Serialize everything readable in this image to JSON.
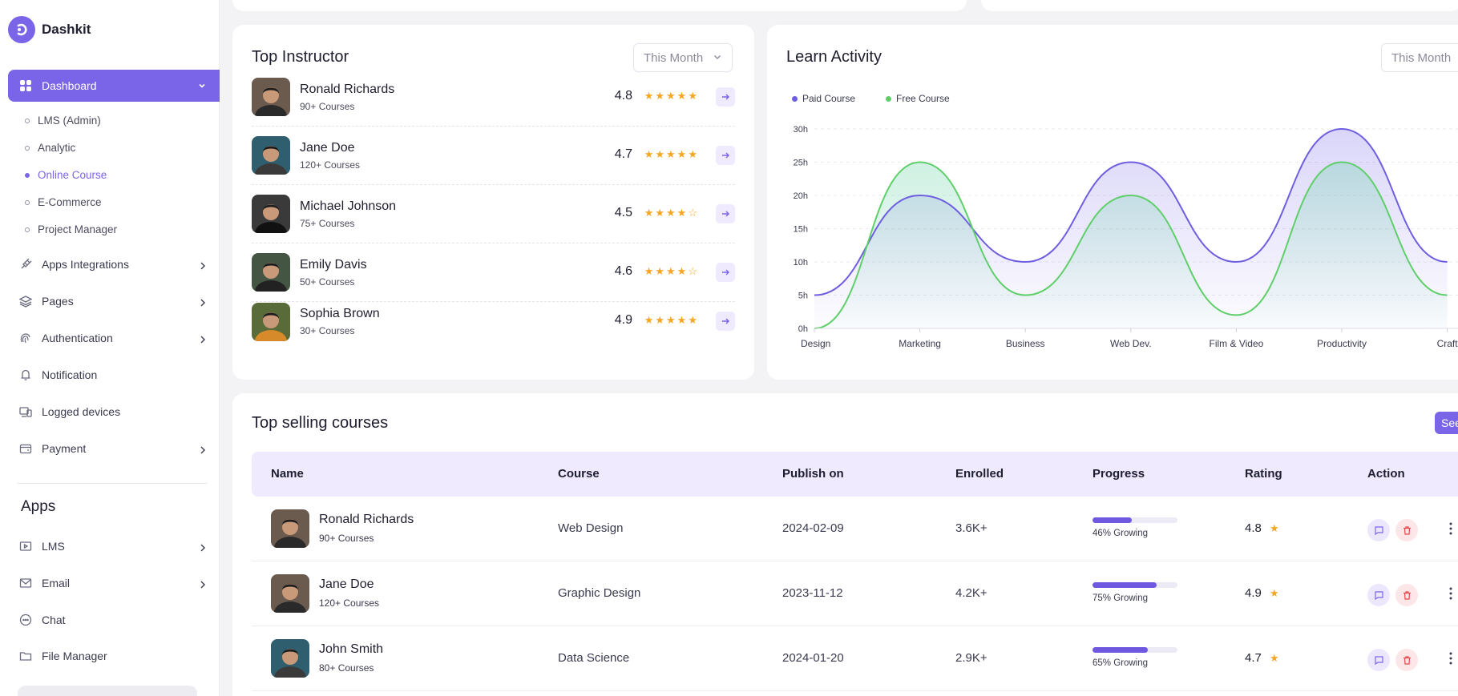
{
  "app": {
    "name": "Dashkit"
  },
  "sidebar": {
    "active": {
      "label": "Dashboard"
    },
    "sub_items": [
      {
        "label": "LMS (Admin)"
      },
      {
        "label": "Analytic"
      },
      {
        "label": "Online Course"
      },
      {
        "label": "E-Commerce"
      },
      {
        "label": "Project Manager"
      }
    ],
    "items": [
      {
        "label": "Apps Integrations",
        "icon": "plug-icon"
      },
      {
        "label": "Pages",
        "icon": "layers-icon"
      },
      {
        "label": "Authentication",
        "icon": "fingerprint-icon"
      },
      {
        "label": "Notification",
        "icon": "bell-icon"
      },
      {
        "label": "Logged devices",
        "icon": "devices-icon"
      },
      {
        "label": "Payment",
        "icon": "wallet-icon"
      }
    ],
    "apps_title": "Apps",
    "apps": [
      {
        "label": "LMS",
        "icon": "video-icon"
      },
      {
        "label": "Email",
        "icon": "mail-icon"
      },
      {
        "label": "Chat",
        "icon": "chat-icon"
      },
      {
        "label": "File Manager",
        "icon": "folder-icon"
      }
    ]
  },
  "top_instructor": {
    "title": "Top Instructor",
    "period": "This Month",
    "rows": [
      {
        "name": "Ronald Richards",
        "courses": "90+ Courses",
        "rating": "4.8",
        "stars": "★★★★★"
      },
      {
        "name": "Jane Doe",
        "courses": "120+ Courses",
        "rating": "4.7",
        "stars": "★★★★★"
      },
      {
        "name": "Michael Johnson",
        "courses": "75+ Courses",
        "rating": "4.5",
        "stars": "★★★★☆"
      },
      {
        "name": "Emily Davis",
        "courses": "50+ Courses",
        "rating": "4.6",
        "stars": "★★★★☆"
      },
      {
        "name": "Sophia Brown",
        "courses": "30+ Courses",
        "rating": "4.9",
        "stars": "★★★★★"
      }
    ]
  },
  "learn_activity": {
    "title": "Learn Activity",
    "period": "This Month"
  },
  "chart_data": {
    "type": "area",
    "categories": [
      "Design",
      "Marketing",
      "Business",
      "Web Dev.",
      "Film & Video",
      "Productivity",
      "Craft"
    ],
    "y_ticks": [
      "0h",
      "5h",
      "10h",
      "15h",
      "20h",
      "25h",
      "30h"
    ],
    "ylim": [
      0,
      30
    ],
    "grid": true,
    "legend_position": "top-left",
    "series": [
      {
        "name": "Paid Course",
        "color": "#6f5fe0",
        "values": [
          5,
          20,
          10,
          25,
          10,
          30,
          10
        ]
      },
      {
        "name": "Free Course",
        "color": "#5fcf6a",
        "values": [
          0,
          25,
          5,
          20,
          2,
          25,
          5
        ]
      }
    ]
  },
  "top_selling": {
    "title": "Top selling courses",
    "see_all": "See",
    "columns": [
      "Name",
      "Course",
      "Publish on",
      "Enrolled",
      "Progress",
      "Rating",
      "Action"
    ],
    "rows": [
      {
        "name": "Ronald Richards",
        "courses": "90+ Courses",
        "course": "Web Design",
        "published": "2024-02-09",
        "enrolled": "3.6K+",
        "progress": 46,
        "progress_label": "46% Growing",
        "rating": "4.8"
      },
      {
        "name": "Jane Doe",
        "courses": "120+ Courses",
        "course": "Graphic Design",
        "published": "2023-11-12",
        "enrolled": "4.2K+",
        "progress": 75,
        "progress_label": "75% Growing",
        "rating": "4.9"
      },
      {
        "name": "John Smith",
        "courses": "80+ Courses",
        "course": "Data Science",
        "published": "2024-01-20",
        "enrolled": "2.9K+",
        "progress": 65,
        "progress_label": "65% Growing",
        "rating": "4.7"
      }
    ]
  },
  "colors": {
    "accent": "#7a64e8",
    "star": "#f5a623",
    "danger": "#e5484d"
  }
}
